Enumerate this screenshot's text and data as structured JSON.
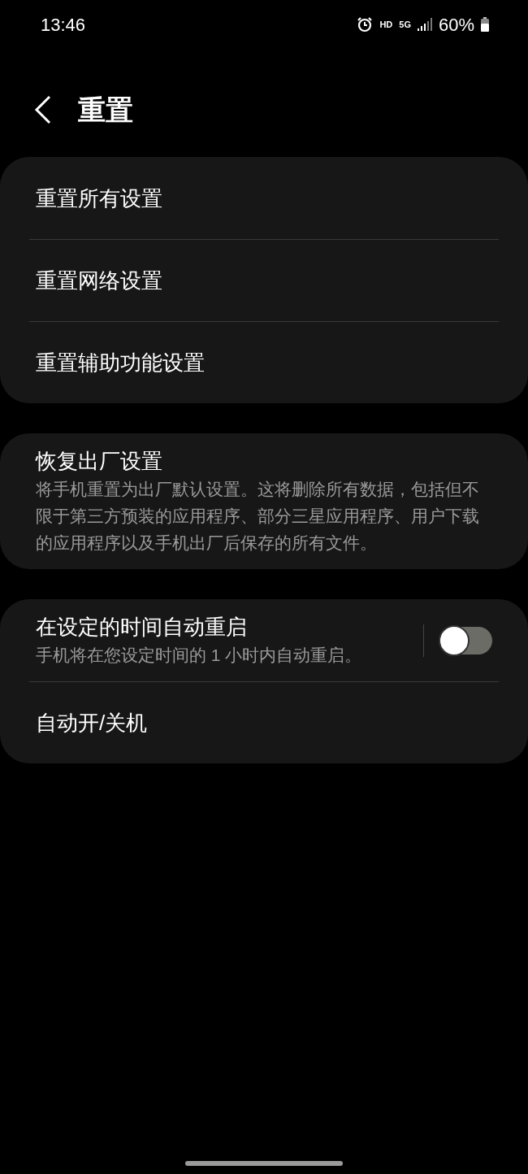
{
  "status_bar": {
    "time": "13:46",
    "indicators": [
      "HD",
      "5G"
    ],
    "battery": "60%"
  },
  "header": {
    "title": "重置"
  },
  "groups": [
    {
      "items": [
        {
          "kind": "link",
          "title": "重置所有设置"
        },
        {
          "kind": "link",
          "title": "重置网络设置"
        },
        {
          "kind": "link",
          "title": "重置辅助功能设置"
        }
      ]
    },
    {
      "items": [
        {
          "kind": "link",
          "title": "恢复出厂设置",
          "description": "将手机重置为出厂默认设置。这将删除所有数据，包括但不限于第三方预装的应用程序、部分三星应用程序、用户下载的应用程序以及手机出厂后保存的所有文件。"
        }
      ]
    },
    {
      "items": [
        {
          "kind": "toggle",
          "title": "在设定的时间自动重启",
          "description": "手机将在您设定时间的 1 小时内自动重启。",
          "on": false
        },
        {
          "kind": "link",
          "title": "自动开/关机"
        }
      ]
    }
  ]
}
